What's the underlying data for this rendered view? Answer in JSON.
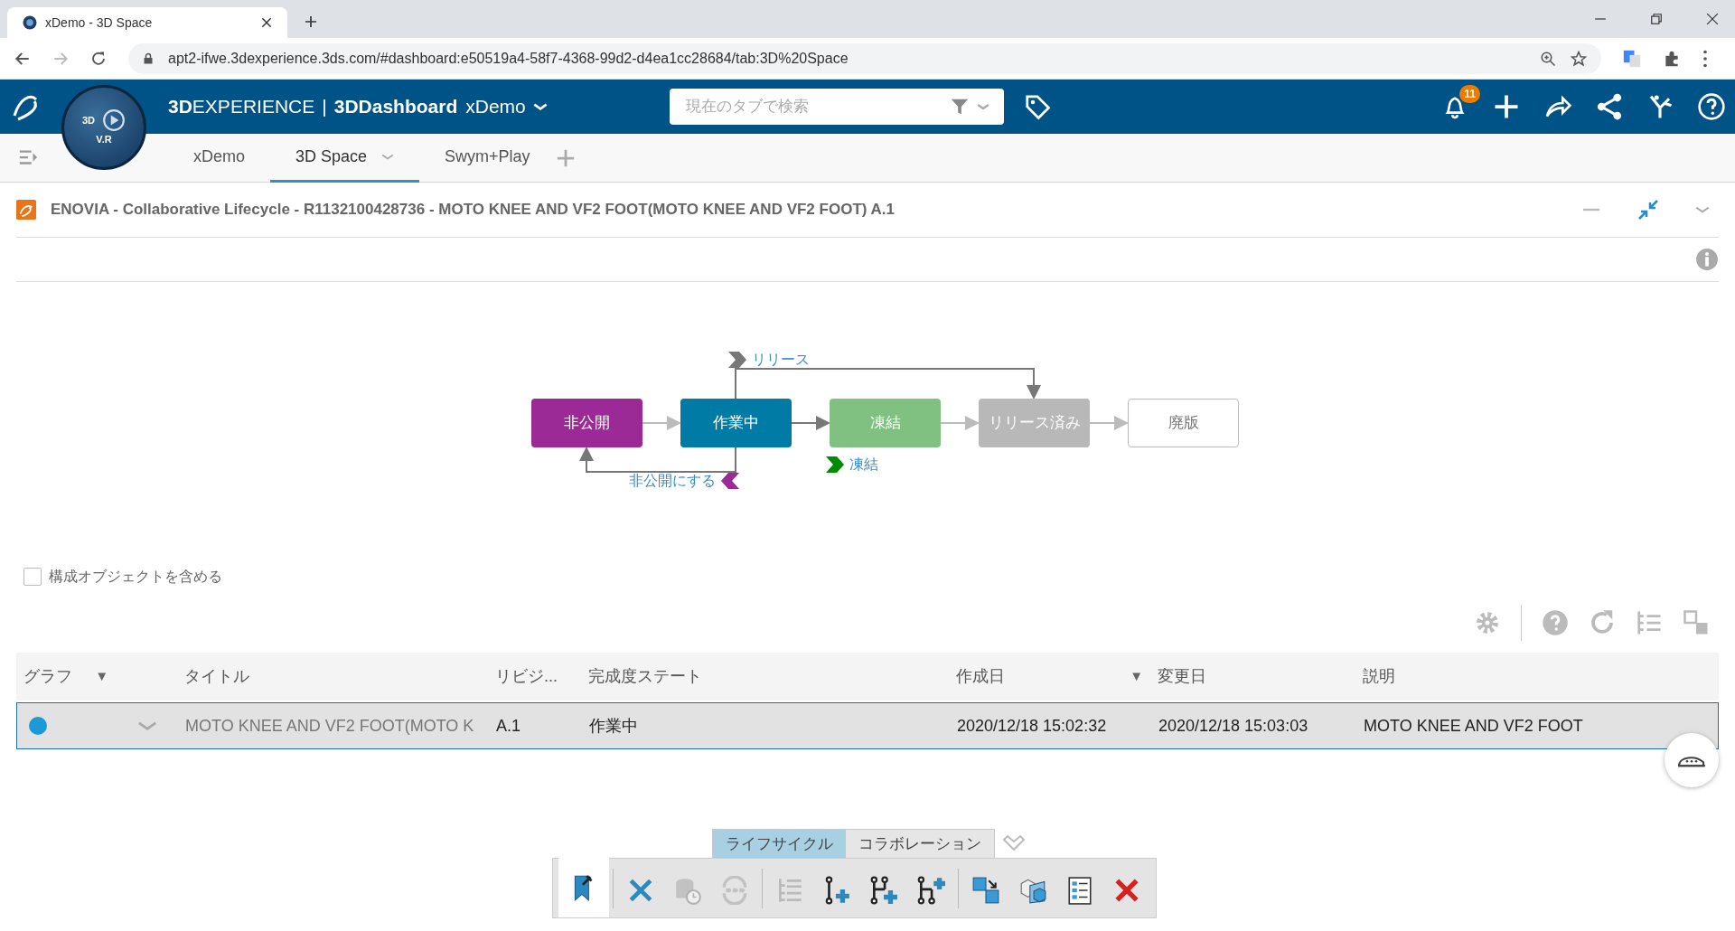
{
  "browser": {
    "tab_title": "xDemo - 3D Space",
    "url": "apt2-ifwe.3dexperience.3ds.com/#dashboard:e50519a4-58f7-4368-99d2-d4ea1cc28684/tab:3D%20Space"
  },
  "app_header": {
    "brand_prefix": "3D",
    "brand_rest": "EXPERIENCE",
    "separator": "|",
    "app": "3DDashboard",
    "dashboard": "xDemo",
    "compass_labels": [
      "3D",
      "V.R"
    ],
    "search": {
      "placeholder": "現在のタブで検索"
    },
    "notification_count": "11"
  },
  "tabs": [
    {
      "label": "xDemo",
      "selected": false
    },
    {
      "label": "3D Space",
      "selected": true
    },
    {
      "label": "Swym+Play",
      "selected": false
    }
  ],
  "widget": {
    "title": "ENOVIA - Collaborative Lifecycle - R1132100428736 - MOTO KNEE AND VF2 FOOT(MOTO KNEE AND VF2 FOOT) A.1"
  },
  "lifecycle": {
    "states": [
      {
        "label": "非公開",
        "color": "#9b2a96"
      },
      {
        "label": "作業中",
        "color": "#007ba6"
      },
      {
        "label": "凍結",
        "color": "#80c080"
      },
      {
        "label": "リリース済み",
        "color": "#b8b8b8"
      },
      {
        "label": "廃版",
        "color": "#ffffff"
      }
    ],
    "transitions": [
      {
        "label": "リリース",
        "color": "#777777"
      },
      {
        "label": "凍結",
        "color": "#008a00"
      },
      {
        "label": "非公開にする",
        "color": "#9b2a96"
      }
    ]
  },
  "include_option": {
    "label": "構成オブジェクトを含める",
    "checked": false
  },
  "table": {
    "columns": [
      {
        "kind": "text",
        "label": "グラフ",
        "marker": "▼"
      },
      {
        "kind": "blank"
      },
      {
        "kind": "text",
        "label": "タイトル"
      },
      {
        "kind": "text",
        "label": "リビジ..."
      },
      {
        "kind": "text",
        "label": "完成度ステート"
      },
      {
        "kind": "text",
        "label": "作成日",
        "marker": "▼"
      },
      {
        "kind": "text",
        "label": "変更日"
      },
      {
        "kind": "text",
        "label": "説明"
      }
    ],
    "rows": [
      {
        "selected": true,
        "color": "#1b9ad6",
        "cells": [
          "",
          "",
          "MOTO KNEE AND VF2 FOOT(MOTO K",
          "A.1",
          "作業中",
          "2020/12/18 15:02:32",
          "2020/12/18 15:03:03",
          "MOTO KNEE AND VF2 FOOT"
        ]
      }
    ]
  },
  "bottom_toolbar": {
    "tabs": [
      {
        "label": "ライフサイクル",
        "selected": true
      },
      {
        "label": "コラボレーション",
        "selected": false
      }
    ],
    "tools": [
      {
        "kind": "bookmark",
        "disabled": false
      },
      {
        "kind": "separator"
      },
      {
        "kind": "cross",
        "disabled": false
      },
      {
        "kind": "database",
        "disabled": true
      },
      {
        "kind": "sync",
        "disabled": true
      },
      {
        "kind": "separator"
      },
      {
        "kind": "tree",
        "disabled": true
      },
      {
        "kind": "revision",
        "disabled": false
      },
      {
        "kind": "branch",
        "disabled": false
      },
      {
        "kind": "merge",
        "disabled": false
      },
      {
        "kind": "separator"
      },
      {
        "kind": "transfer",
        "disabled": false
      },
      {
        "kind": "cubes",
        "disabled": false
      },
      {
        "kind": "list",
        "disabled": false
      },
      {
        "kind": "delete",
        "disabled": false
      }
    ]
  }
}
